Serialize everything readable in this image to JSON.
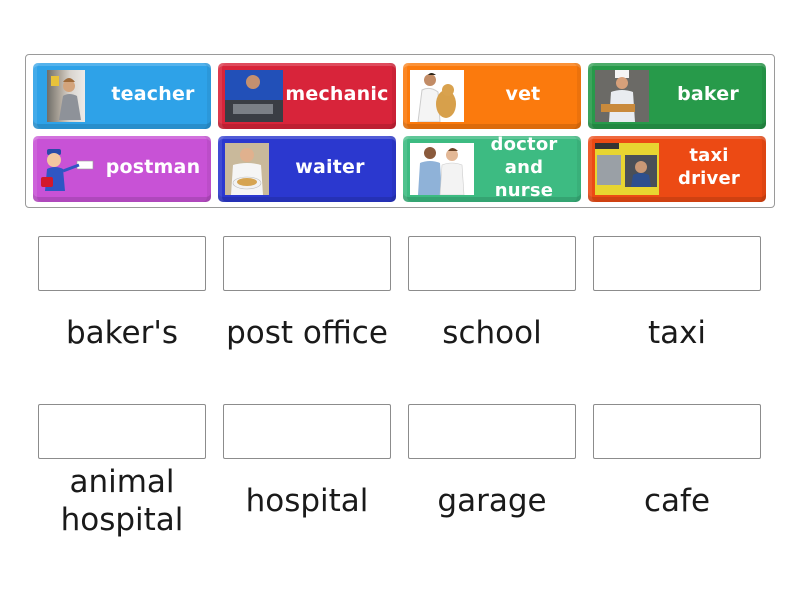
{
  "activity": "match-up",
  "tiles": [
    {
      "label": "teacher",
      "color": "#2ea2e8",
      "image": "teacher-photo"
    },
    {
      "label": "mechanic",
      "color": "#d8243a",
      "image": "mechanic-photo"
    },
    {
      "label": "vet",
      "color": "#fb7a0d",
      "image": "vet-photo"
    },
    {
      "label": "baker",
      "color": "#279a4a",
      "image": "baker-photo"
    },
    {
      "label": "postman",
      "color": "#c852d6",
      "image": "postman-cartoon"
    },
    {
      "label": "waiter",
      "color": "#2b38cf",
      "image": "waiter-photo"
    },
    {
      "label": "doctor and nurse",
      "line1": "doctor",
      "line2": "and nurse",
      "color": "#3dbb82",
      "image": "doctor-nurse-photo"
    },
    {
      "label": "taxi driver",
      "line1": "taxi",
      "line2": "driver",
      "color": "#ec4a14",
      "image": "taxi-driver-photo"
    }
  ],
  "targets": [
    {
      "label": "baker's"
    },
    {
      "label": "post office"
    },
    {
      "label": "school"
    },
    {
      "label": "taxi"
    },
    {
      "label": "animal hospital",
      "line1": "animal",
      "line2": "hospital"
    },
    {
      "label": "hospital"
    },
    {
      "label": "garage"
    },
    {
      "label": "cafe"
    }
  ]
}
